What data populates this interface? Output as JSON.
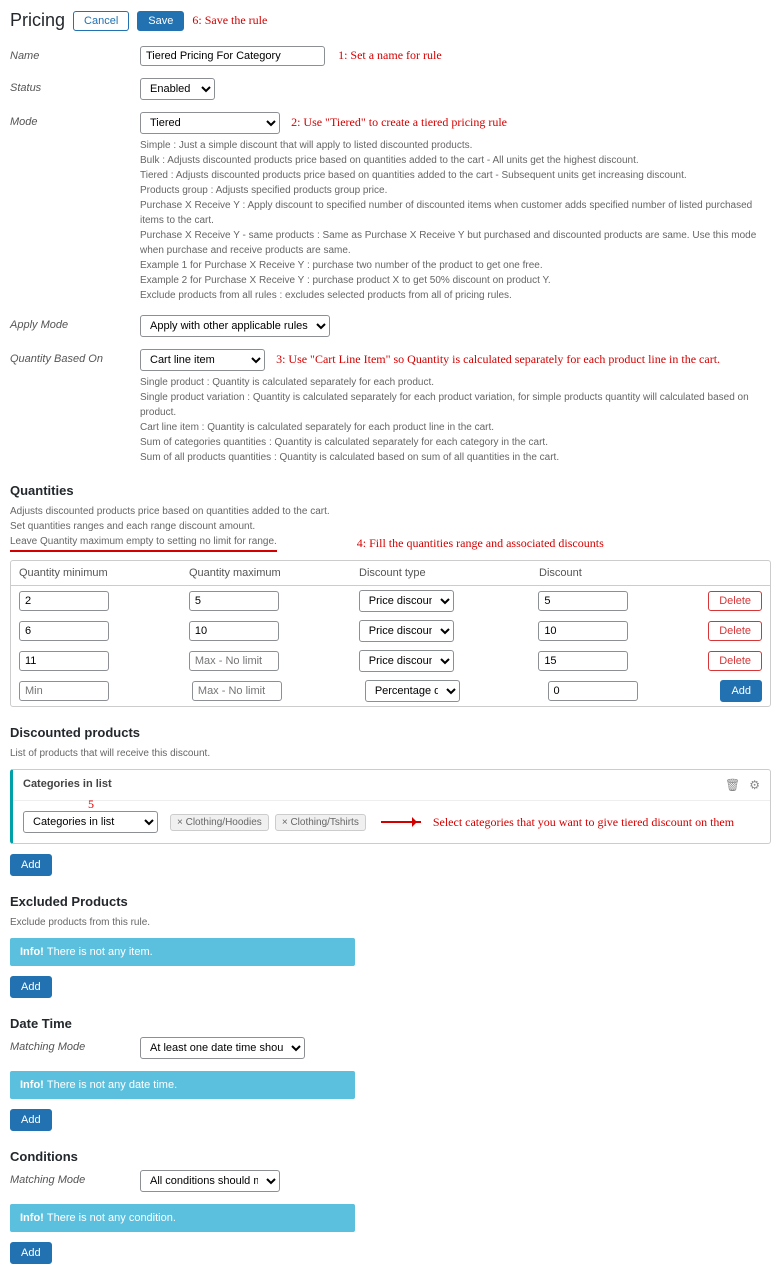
{
  "header": {
    "title": "Pricing",
    "cancel": "Cancel",
    "save": "Save"
  },
  "annotations": {
    "a1": "1: Set a name for rule",
    "a2": "2: Use \"Tiered\" to create a tiered pricing rule",
    "a3": "3: Use \"Cart Line Item\" so Quantity is calculated separately for each product line in the cart.",
    "a4": "4: Fill the quantities range and associated discounts",
    "a5": "5",
    "a5b": "Select categories that you want to give tiered discount on them",
    "a6": "6: Save the rule"
  },
  "labels": {
    "name": "Name",
    "status": "Status",
    "mode": "Mode",
    "applyMode": "Apply Mode",
    "qtyBased": "Quantity Based On",
    "matchingMode": "Matching Mode"
  },
  "values": {
    "name": "Tiered Pricing For Category",
    "status": "Enabled",
    "mode": "Tiered",
    "applyMode": "Apply with other applicable rules",
    "qtyBased": "Cart line item",
    "dtMatching": "At least one date time should match",
    "condMatching": "All conditions should match",
    "catSelect": "Categories in list"
  },
  "modeHelp": [
    "Simple : Just a simple discount that will apply to listed discounted products.",
    "Bulk : Adjusts discounted products price based on quantities added to the cart - All units get the highest discount.",
    "Tiered : Adjusts discounted products price based on quantities added to the cart - Subsequent units get increasing discount.",
    "Products group : Adjusts specified products group price.",
    "Purchase X Receive Y : Apply discount to specified number of discounted items when customer adds specified number of listed purchased items to the cart.",
    "Purchase X Receive Y - same products : Same as Purchase X Receive Y but purchased and discounted products are same. Use this mode when purchase and receive products are same.",
    "Example 1 for Purchase X Receive Y : purchase two number of the product to get one free.",
    "Example 2 for Purchase X Receive Y : purchase product X to get 50% discount on product Y.",
    "Exclude products from all rules : excludes selected products from all of pricing rules."
  ],
  "qtyHelp": [
    "Single product : Quantity is calculated separately for each product.",
    "Single product variation : Quantity is calculated separately for each product variation, for simple products quantity will calculated based on product.",
    "Cart line item : Quantity is calculated separately for each product line in the cart.",
    "Sum of categories quantities : Quantity is calculated separately for each category in the cart.",
    "Sum of all products quantities : Quantity is calculated based on sum of all quantities in the cart."
  ],
  "sections": {
    "quantities": "Quantities",
    "qDesc1": "Adjusts discounted products price based on quantities added to the cart.",
    "qDesc2": "Set quantities ranges and each range discount amount.",
    "qDesc3": "Leave Quantity maximum empty to setting no limit for range.",
    "discounted": "Discounted products",
    "discDesc": "List of products that will receive this discount.",
    "catInList": "Categories in list",
    "excluded": "Excluded Products",
    "exclDesc": "Exclude products from this rule.",
    "dateTime": "Date Time",
    "conditions": "Conditions"
  },
  "tableHeaders": {
    "qmin": "Quantity minimum",
    "qmax": "Quantity maximum",
    "dtype": "Discount type",
    "disc": "Discount"
  },
  "tableRows": [
    {
      "min": "2",
      "max": "5",
      "type": "Price discount",
      "disc": "5",
      "btn": "Delete"
    },
    {
      "min": "6",
      "max": "10",
      "type": "Price discount",
      "disc": "10",
      "btn": "Delete"
    },
    {
      "min": "11",
      "max": "",
      "maxPh": "Max - No limit",
      "type": "Price discount",
      "disc": "15",
      "btn": "Delete"
    },
    {
      "min": "",
      "minPh": "Min",
      "max": "",
      "maxPh": "Max - No limit",
      "type": "Percentage discount",
      "disc": "0",
      "btn": "Add"
    }
  ],
  "tags": [
    "× Clothing/Hoodies",
    "× Clothing/Tshirts"
  ],
  "info": {
    "noItem": "There is not any item.",
    "noDate": "There is not any date time.",
    "noCond": "There is not any condition.",
    "infoLabel": "Info! "
  },
  "buttons": {
    "add": "Add",
    "delete": "Delete"
  }
}
